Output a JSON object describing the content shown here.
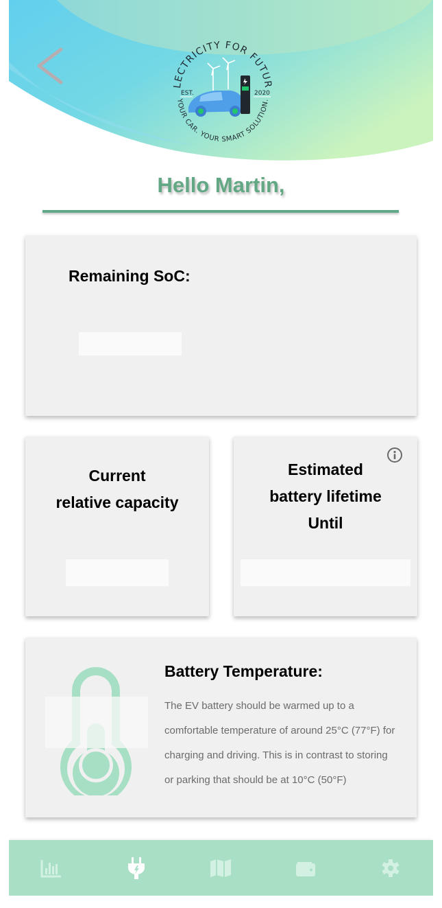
{
  "header": {
    "logo": {
      "top_text": "ELECTRICITY FOR FUTURE",
      "bottom_text": "YOUR CAR. YOUR SMART SOLUTION.",
      "est_label": "EST.",
      "year": "2020"
    },
    "back_icon": "chevron-left-icon"
  },
  "greeting": "Hello Martin,",
  "cards": {
    "soc": {
      "title": "Remaining SoC:"
    },
    "capacity": {
      "title_line1": "Current",
      "title_line2": "relative capacity"
    },
    "lifetime": {
      "title_line1": "Estimated",
      "title_line2": "battery lifetime",
      "title_line3": "Until",
      "info_icon": "info-icon"
    },
    "temperature": {
      "title": "Battery Temperature:",
      "description": "The EV battery should be warmed up to a comfortable temperature of around 25°C (77°F) for charging and driving. This is in contrast to storing or parking that should be at 10°C (50°F)"
    }
  },
  "bottom_nav": {
    "items": [
      {
        "icon": "bar-chart-icon",
        "active": false
      },
      {
        "icon": "plug-icon",
        "active": true
      },
      {
        "icon": "map-icon",
        "active": false
      },
      {
        "icon": "wallet-icon",
        "active": false
      },
      {
        "icon": "gear-icon",
        "active": false
      }
    ]
  },
  "colors": {
    "accent_green": "#63a884",
    "nav_background": "#a8dfc5",
    "header_blue": "#5bc9ee",
    "header_green": "#c8f2c0",
    "thermometer": "#a6dfc3"
  }
}
